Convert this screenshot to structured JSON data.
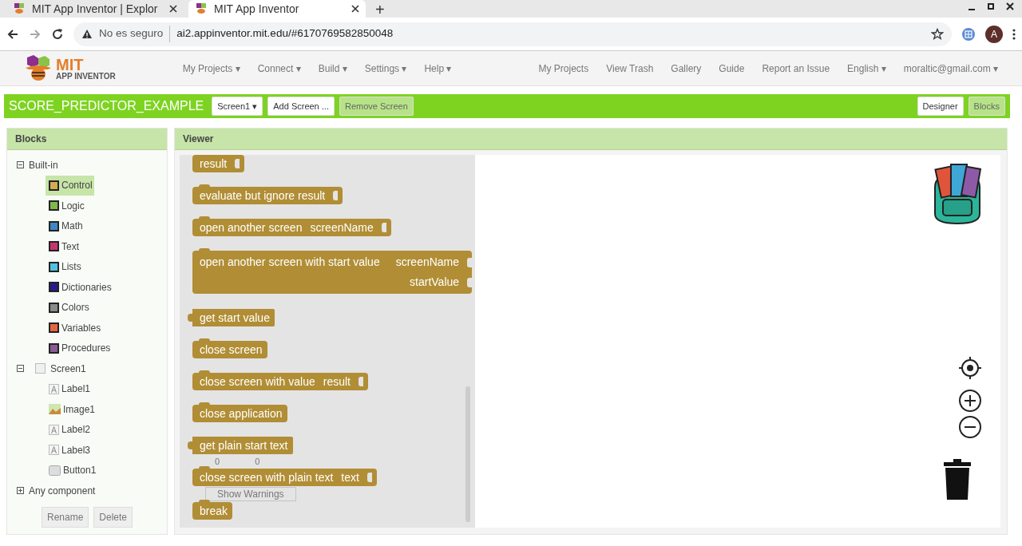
{
  "browser": {
    "tabs": [
      {
        "title": "MIT App Inventor | Explor",
        "selected": false
      },
      {
        "title": "MIT App Inventor",
        "selected": true
      }
    ],
    "new_tab": "+",
    "security": "No es seguro",
    "url": "ai2.appinventor.mit.edu/#6170769582850048",
    "avatar": "A"
  },
  "logo": {
    "title": "MIT",
    "subtitle": "APP INVENTOR"
  },
  "menus": [
    "My Projects ▾",
    "Connect ▾",
    "Build ▾",
    "Settings ▾",
    "Help ▾"
  ],
  "links": [
    "My Projects",
    "View Trash",
    "Gallery",
    "Guide",
    "Report an Issue",
    "English ▾",
    "moraltic@gmail.com ▾"
  ],
  "project": {
    "name": "SCORE_PREDICTOR_EXAMPLE",
    "buttons": [
      {
        "label": "Screen1 ▾",
        "disabled": false
      },
      {
        "label": "Add Screen ...",
        "disabled": false
      },
      {
        "label": "Remove Screen",
        "disabled": true
      }
    ],
    "modes": [
      {
        "label": "Designer",
        "selected": false
      },
      {
        "label": "Blocks",
        "selected": true
      }
    ]
  },
  "blocks_panel": {
    "title": "Blocks",
    "tree": [
      {
        "label": "Built-in",
        "expanded": true,
        "kind": "group",
        "children": [
          {
            "label": "Control",
            "color": "#d4aa52",
            "selected": true
          },
          {
            "label": "Logic",
            "color": "#7fb84c",
            "selected": false
          },
          {
            "label": "Math",
            "color": "#3f86c2",
            "selected": false
          },
          {
            "label": "Text",
            "color": "#c53770",
            "selected": false
          },
          {
            "label": "Lists",
            "color": "#4fc3de",
            "selected": false
          },
          {
            "label": "Dictionaries",
            "color": "#2a1a8e",
            "selected": false
          },
          {
            "label": "Colors",
            "color": "#8a8a8a",
            "selected": false
          },
          {
            "label": "Variables",
            "color": "#e0683e",
            "selected": false
          },
          {
            "label": "Procedures",
            "color": "#8a5a94",
            "selected": false
          }
        ]
      },
      {
        "label": "Screen1",
        "expanded": true,
        "kind": "screen",
        "children": [
          {
            "label": "Label1",
            "kind": "label",
            "selected": false
          },
          {
            "label": "Image1",
            "kind": "image",
            "selected": false
          },
          {
            "label": "Label2",
            "kind": "label",
            "selected": false
          },
          {
            "label": "Label3",
            "kind": "label",
            "selected": false
          },
          {
            "label": "Button1",
            "kind": "button",
            "selected": false
          }
        ]
      },
      {
        "label": "Any component",
        "expanded": false,
        "kind": "group"
      }
    ],
    "buttons": [
      "Rename",
      "Delete"
    ]
  },
  "viewer": {
    "title": "Viewer",
    "warnings_button": "Show Warnings",
    "warning_count": "0",
    "error_count": "0",
    "blocks": [
      {
        "kind": "statement",
        "text": "result",
        "has_input": true
      },
      {
        "kind": "statement",
        "text": "evaluate but ignore result",
        "has_input": true
      },
      {
        "kind": "statement",
        "text": "open another screen",
        "inputs": [
          "screenName"
        ]
      },
      {
        "kind": "statement",
        "text": "open another screen with start value",
        "inputs": [
          "screenName",
          "startValue"
        ]
      },
      {
        "kind": "value",
        "text": "get start value"
      },
      {
        "kind": "statement",
        "text": "close screen"
      },
      {
        "kind": "statement",
        "text": "close screen with value",
        "inputs": [
          "result"
        ]
      },
      {
        "kind": "statement",
        "text": "close application"
      },
      {
        "kind": "value",
        "text": "get plain start text"
      },
      {
        "kind": "statement",
        "text": "close screen with plain text",
        "inputs": [
          "text"
        ]
      },
      {
        "kind": "statement",
        "text": "break"
      }
    ]
  }
}
